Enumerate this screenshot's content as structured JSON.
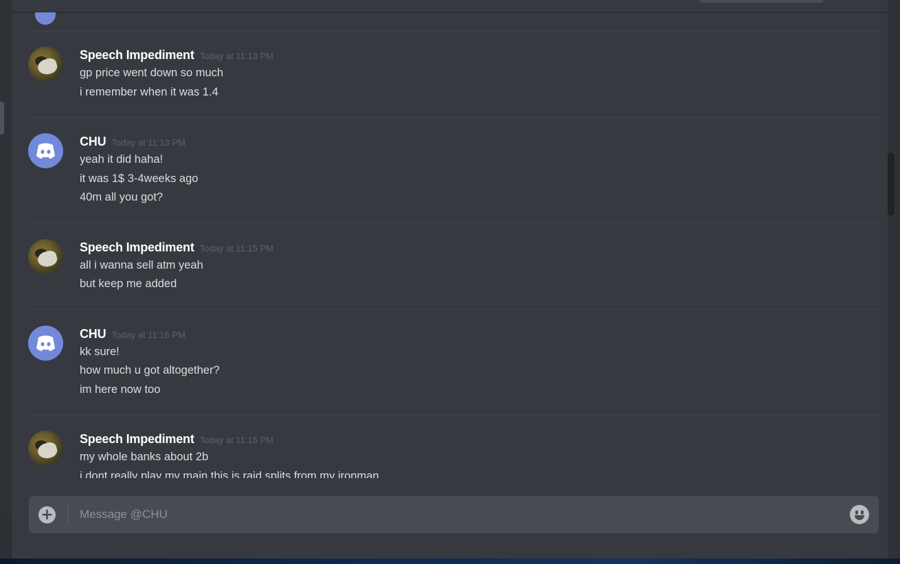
{
  "conversation": {
    "messages": [
      {
        "author": "Speech Impediment",
        "timestamp": "Today at 11:13 PM",
        "avatar": "photo",
        "lines": [
          "gp price went down so much",
          "i remember when it was 1.4"
        ]
      },
      {
        "author": "CHU",
        "timestamp": "Today at 11:13 PM",
        "avatar": "discord-logo",
        "lines": [
          "yeah it did haha!",
          "it was 1$ 3-4weeks ago",
          "40m all you got?"
        ]
      },
      {
        "author": "Speech Impediment",
        "timestamp": "Today at 11:15 PM",
        "avatar": "photo",
        "lines": [
          "all i wanna sell atm yeah",
          "but keep me added"
        ]
      },
      {
        "author": "CHU",
        "timestamp": "Today at 11:16 PM",
        "avatar": "discord-logo",
        "lines": [
          "kk sure!",
          "how much u got altogether?",
          "im here now too"
        ]
      },
      {
        "author": "Speech Impediment",
        "timestamp": "Today at 11:16 PM",
        "avatar": "photo",
        "lines": [
          "my whole banks about 2b",
          "i dont really play my main this is raid splits from my ironman"
        ]
      }
    ]
  },
  "composer": {
    "placeholder": "Message @CHU",
    "value": "",
    "add_icon": "plus-circle-icon",
    "emoji_icon": "smiley-icon"
  },
  "colors": {
    "background": "#36393f",
    "accent": "#7289da",
    "username": "#ffffff",
    "message_text": "#dcddde",
    "timestamp": "#5e6269"
  }
}
